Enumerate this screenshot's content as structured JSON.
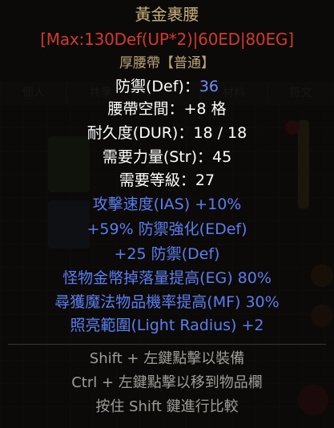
{
  "background": {
    "tabs": [
      "個人",
      "共享",
      "",
      "材料",
      "符文"
    ]
  },
  "item": {
    "name": "黃金裹腰",
    "affix": "[Max:130Def(UP*2)|60ED|80EG]",
    "base_type": "厚腰帶【普通】",
    "stats": [
      {
        "label": "防禦(Def)：",
        "value": "36",
        "value_blue": true
      },
      {
        "label": "腰帶空間：",
        "value": "+8 格",
        "value_blue": false
      },
      {
        "label": "耐久度(DUR)：",
        "value": "18 / 18",
        "value_blue": false
      },
      {
        "label": "需要力量(Str)：",
        "value": "45",
        "value_blue": false
      },
      {
        "label": "需要等級：",
        "value": "27",
        "value_blue": false
      }
    ],
    "magic_props": [
      "攻擊速度(IAS) +10%",
      "+59% 防禦強化(EDef)",
      "+25 防禦(Def)",
      "怪物金幣掉落量提高(EG) 80%",
      "尋獲魔法物品機率提高(MF) 30%",
      "照亮範圍(Light Radius) +2"
    ],
    "hints": [
      "Shift + 左鍵點擊以裝備",
      "Ctrl + 左鍵點擊以移到物品欄",
      "按住 Shift 鍵進行比較"
    ]
  },
  "colors": {
    "unique_name": "#c9b27a",
    "affix_red": "#d13a2c",
    "magic_blue": "#5d7df0",
    "stat_blue": "#6f8cff",
    "hint_gray": "#a09d99"
  }
}
